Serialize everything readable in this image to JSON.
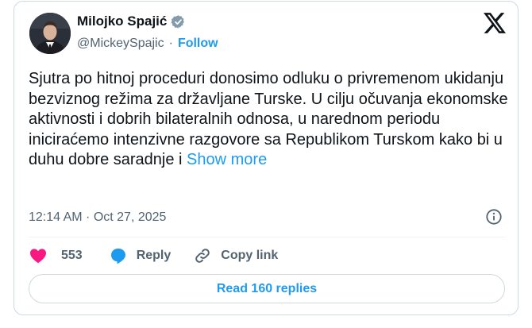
{
  "author": {
    "name": "Milojko Spajić",
    "handle": "@MickeySpajic",
    "separator": "·",
    "follow_label": "Follow"
  },
  "tweet": {
    "text": "Sjutra po hitnoj proceduri donosimo odluku o privremenom ukidanju bezviznog režima za državljane Turske. U cilju očuvanja ekonomske aktivnosti i dobrih bilateralnih odnosa, u narednom periodu iniciraćemo intenzivne razgovore sa Republikom Turskom kako bi u duhu dobre saradnje i",
    "show_more_label": "Show more",
    "timestamp": "12:14 AM · Oct 27, 2025"
  },
  "actions": {
    "likes_count": "553",
    "reply_label": "Reply",
    "copy_link_label": "Copy link"
  },
  "read_replies_label": "Read 160 replies",
  "colors": {
    "accent": "#1d9bf0",
    "like": "#f91880",
    "text": "#0f1419",
    "muted": "#536471",
    "border": "#cfd9de"
  },
  "icons": [
    "verified-badge-icon",
    "x-logo-icon",
    "info-icon",
    "heart-icon",
    "reply-bubble-icon",
    "link-icon"
  ]
}
